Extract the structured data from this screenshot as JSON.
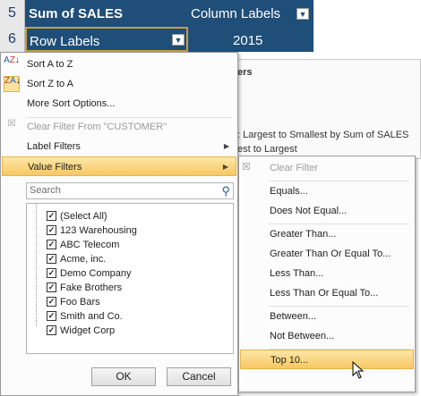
{
  "sheet": {
    "row5": "5",
    "row6": "6",
    "sum_label": "Sum of SALES",
    "column_labels": "Column Labels",
    "row_labels": "Row Labels",
    "year": "2015"
  },
  "background_panel": {
    "heading_fragment": "ers",
    "line1": ": Largest to Smallest by Sum of SALES",
    "line2": "est to Largest"
  },
  "menu": {
    "sort_az": "Sort A to Z",
    "sort_za": "Sort Z to A",
    "more_sort": "More Sort Options...",
    "clear_filter": "Clear Filter From \"CUSTOMER\"",
    "label_filters": "Label Filters",
    "value_filters": "Value Filters",
    "search_placeholder": "Search",
    "items": [
      "(Select All)",
      "123 Warehousing",
      "ABC Telecom",
      "Acme, inc.",
      "Demo Company",
      "Fake Brothers",
      "Foo Bars",
      "Smith and Co.",
      "Widget Corp"
    ],
    "ok": "OK",
    "cancel": "Cancel"
  },
  "submenu": {
    "clear_filter": "Clear Filter",
    "equals": "Equals...",
    "does_not_equal": "Does Not Equal...",
    "greater_than": "Greater Than...",
    "greater_than_or_equal": "Greater Than Or Equal To...",
    "less_than": "Less Than...",
    "less_than_or_equal": "Less Than Or Equal To...",
    "between": "Between...",
    "not_between": "Not Between...",
    "top10": "Top 10..."
  },
  "colors": {
    "header": "#1f4e79",
    "highlight": "#f7c763"
  }
}
